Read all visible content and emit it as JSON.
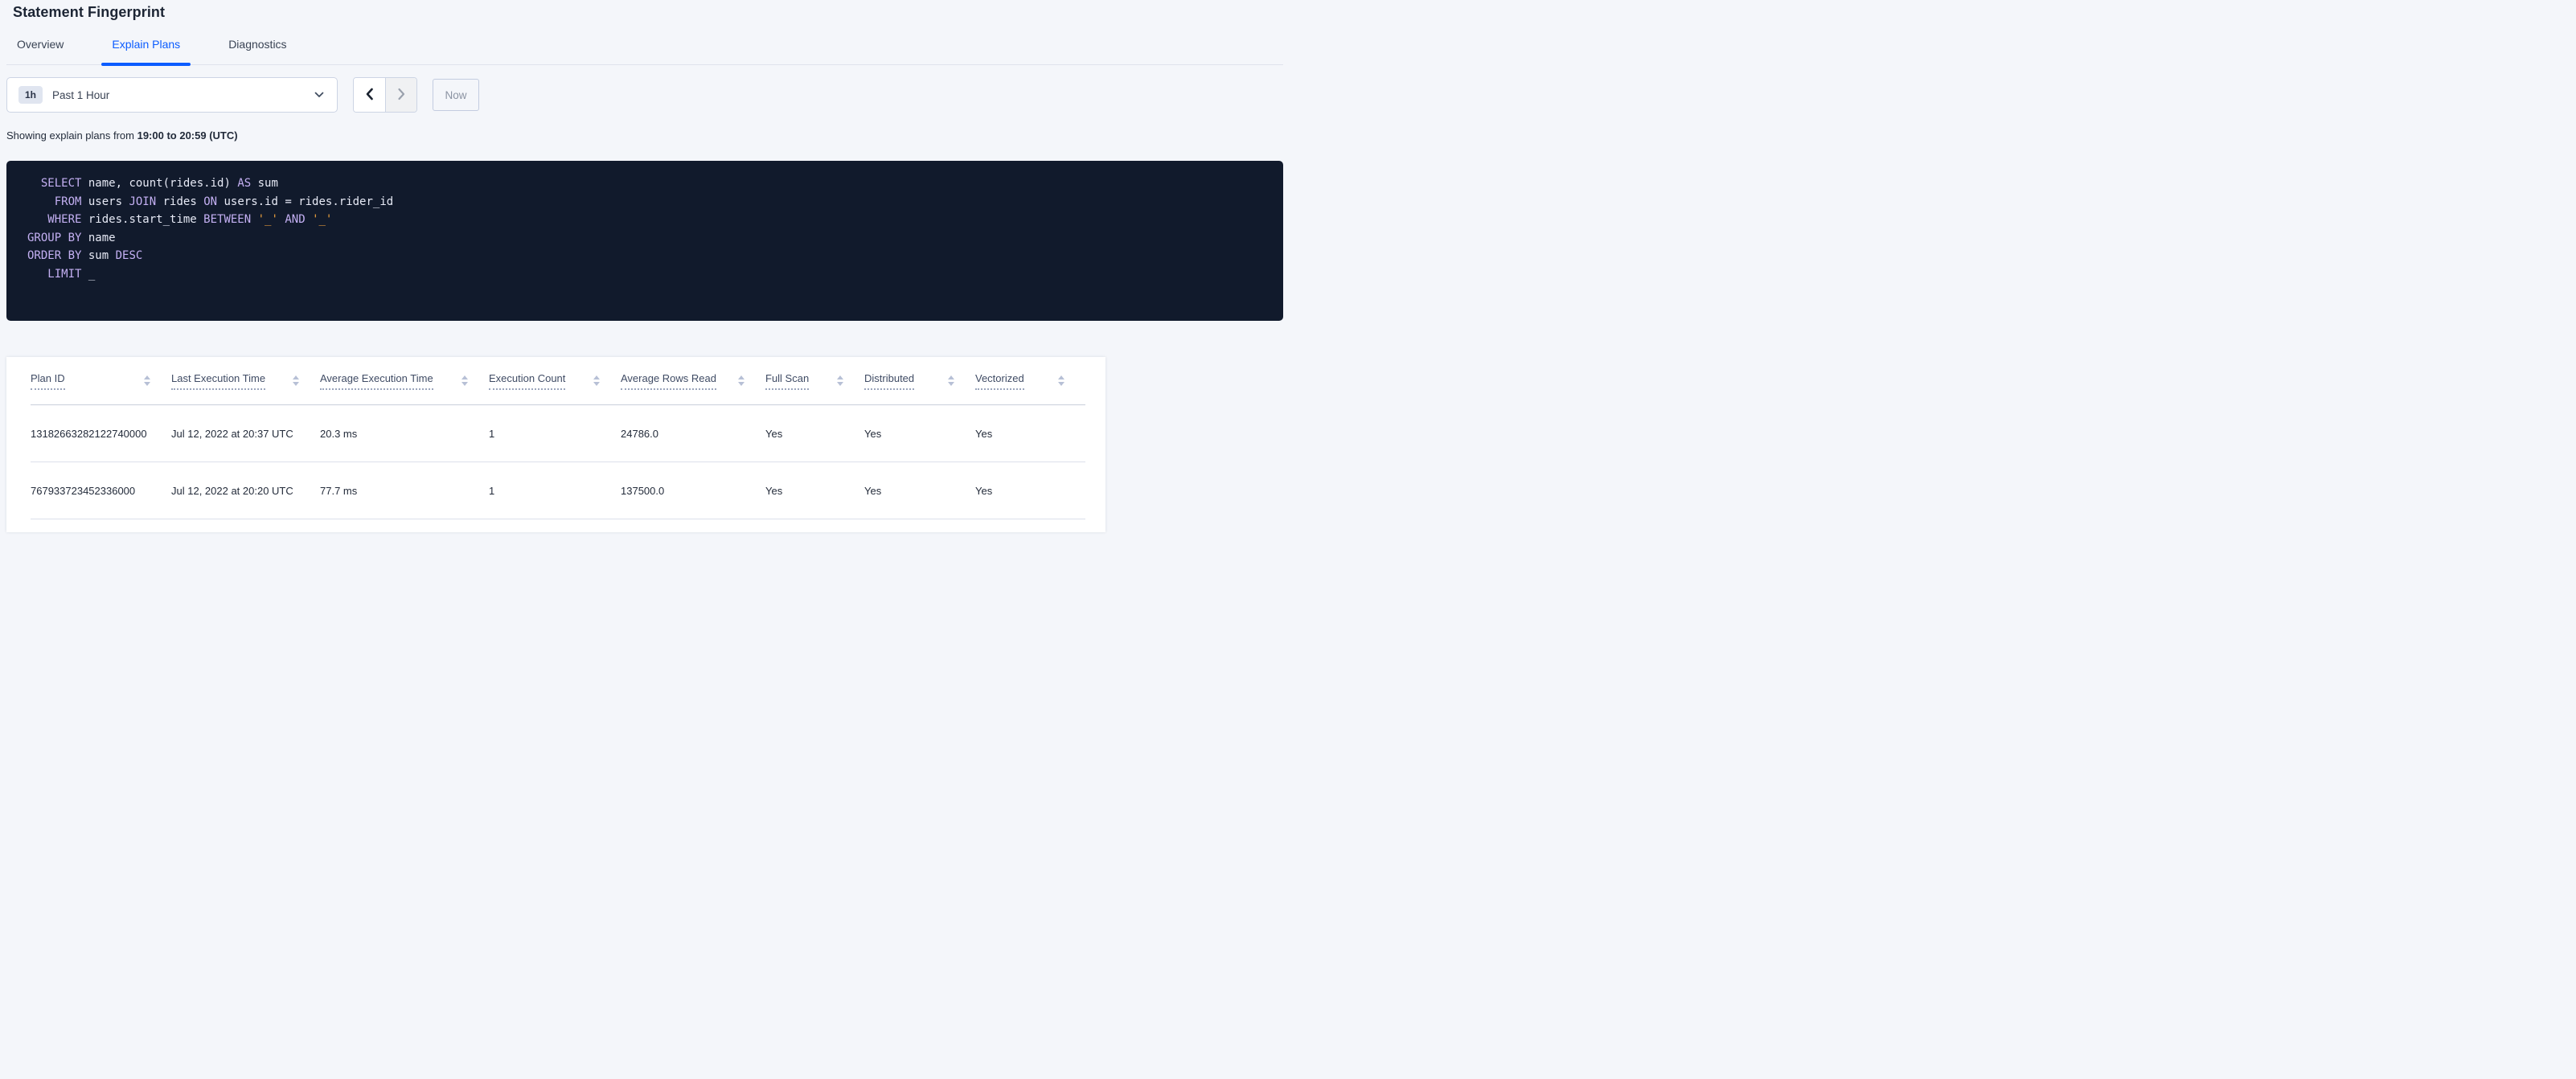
{
  "page": {
    "title": "Statement Fingerprint"
  },
  "colors": {
    "accent_blue": "#0b5cff",
    "page_background": "#f4f6fa",
    "sql_background": "#111a2c",
    "sql_keyword": "#c4b0f3",
    "sql_identifier": "#e7eaf6",
    "sql_string": "#efa23d",
    "sql_placeholder": "#d9dee9",
    "sort_icon": "#b7c0d6"
  },
  "tabs": {
    "items": [
      {
        "label": "Overview",
        "active": false
      },
      {
        "label": "Explain Plans",
        "active": true
      },
      {
        "label": "Diagnostics",
        "active": false
      }
    ]
  },
  "time_controls": {
    "interval_badge": "1h",
    "interval_label": "Past 1 Hour",
    "prev_icon": "chevron-left",
    "next_icon": "chevron-right",
    "next_disabled": true,
    "now_label": "Now"
  },
  "status_line": {
    "prefix": "Showing explain plans from ",
    "range": "19:00 to 20:59 (UTC)"
  },
  "sql_box": {
    "lines": [
      [
        {
          "t": "kw",
          "v": "  SELECT"
        },
        {
          "t": "id",
          "v": " name, count(rides.id) "
        },
        {
          "t": "kw",
          "v": "AS"
        },
        {
          "t": "id",
          "v": " sum"
        }
      ],
      [
        {
          "t": "kw",
          "v": "    FROM"
        },
        {
          "t": "id",
          "v": " users "
        },
        {
          "t": "kw",
          "v": "JOIN"
        },
        {
          "t": "id",
          "v": " rides "
        },
        {
          "t": "kw",
          "v": "ON"
        },
        {
          "t": "id",
          "v": " users.id = rides.rider_id"
        }
      ],
      [
        {
          "t": "kw",
          "v": "   WHERE"
        },
        {
          "t": "id",
          "v": " rides.start_time "
        },
        {
          "t": "kw",
          "v": "BETWEEN"
        },
        {
          "t": "id",
          "v": " "
        },
        {
          "t": "str",
          "v": "'_'"
        },
        {
          "t": "id",
          "v": " "
        },
        {
          "t": "kw",
          "v": "AND"
        },
        {
          "t": "id",
          "v": " "
        },
        {
          "t": "str",
          "v": "'_'"
        }
      ],
      [
        {
          "t": "kw",
          "v": "GROUP BY"
        },
        {
          "t": "id",
          "v": " name"
        }
      ],
      [
        {
          "t": "kw",
          "v": "ORDER BY"
        },
        {
          "t": "id",
          "v": " sum "
        },
        {
          "t": "kw",
          "v": "DESC"
        }
      ],
      [
        {
          "t": "kw",
          "v": "   LIMIT"
        },
        {
          "t": "ph",
          "v": " _"
        }
      ]
    ]
  },
  "plans_table": {
    "columns": [
      {
        "label": "Plan ID"
      },
      {
        "label": "Last Execution Time"
      },
      {
        "label": "Average Execution Time"
      },
      {
        "label": "Execution Count"
      },
      {
        "label": "Average Rows Read"
      },
      {
        "label": "Full Scan"
      },
      {
        "label": "Distributed"
      },
      {
        "label": "Vectorized"
      }
    ],
    "rows": [
      [
        "13182663282122740000",
        "Jul 12, 2022 at 20:37 UTC",
        "20.3 ms",
        "1",
        "24786.0",
        "Yes",
        "Yes",
        "Yes"
      ],
      [
        "767933723452336000",
        "Jul 12, 2022 at 20:20 UTC",
        "77.7 ms",
        "1",
        "137500.0",
        "Yes",
        "Yes",
        "Yes"
      ]
    ]
  }
}
